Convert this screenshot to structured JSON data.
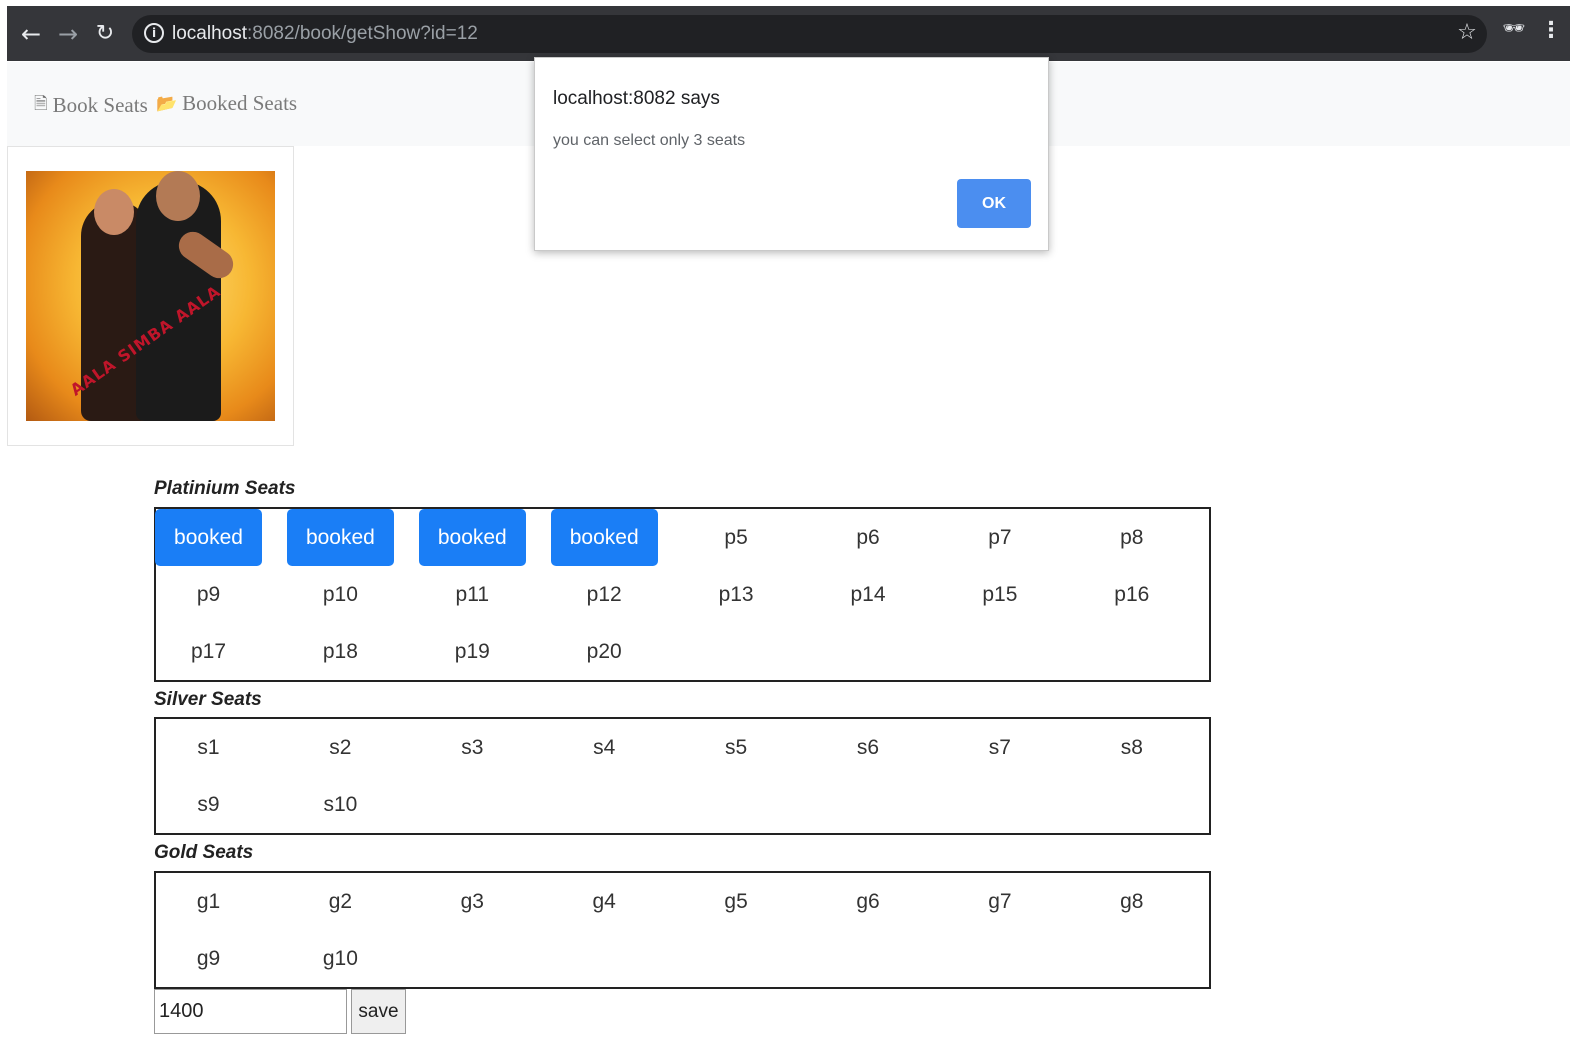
{
  "browser": {
    "url_host": "localhost",
    "url_rest": ":8082/book/getShow?id=12",
    "icons": {
      "back": "back-arrow-icon",
      "forward": "forward-arrow-icon",
      "reload": "reload-icon",
      "info": "info-icon",
      "bookmark": "bookmark-star-icon",
      "incognito": "incognito-icon",
      "menu": "kebab-menu-icon"
    }
  },
  "nav": {
    "book_seats": "Book Seats",
    "booked_seats": "Booked Seats"
  },
  "dialog": {
    "title": "localhost:8082 says",
    "message": "you can select only 3 seats",
    "ok_label": "OK"
  },
  "sections": {
    "platinum": {
      "title": "Platinium Seats",
      "seats": [
        "booked",
        "booked",
        "booked",
        "booked",
        "p5",
        "p6",
        "p7",
        "p8",
        "p9",
        "p10",
        "p11",
        "p12",
        "p13",
        "p14",
        "p15",
        "p16",
        "p17",
        "p18",
        "p19",
        "p20"
      ]
    },
    "silver": {
      "title": "Silver Seats",
      "seats": [
        "s1",
        "s2",
        "s3",
        "s4",
        "s5",
        "s6",
        "s7",
        "s8",
        "s9",
        "s10"
      ]
    },
    "gold": {
      "title": "Gold Seats",
      "seats": [
        "g1",
        "g2",
        "g3",
        "g4",
        "g5",
        "g6",
        "g7",
        "g8",
        "g9",
        "g10"
      ]
    }
  },
  "form": {
    "amount_value": "1400",
    "save_label": "save"
  },
  "colors": {
    "booked_seat": "#1a7ef6",
    "dialog_ok": "#4b8ef0",
    "chrome_bar": "#35363a"
  }
}
